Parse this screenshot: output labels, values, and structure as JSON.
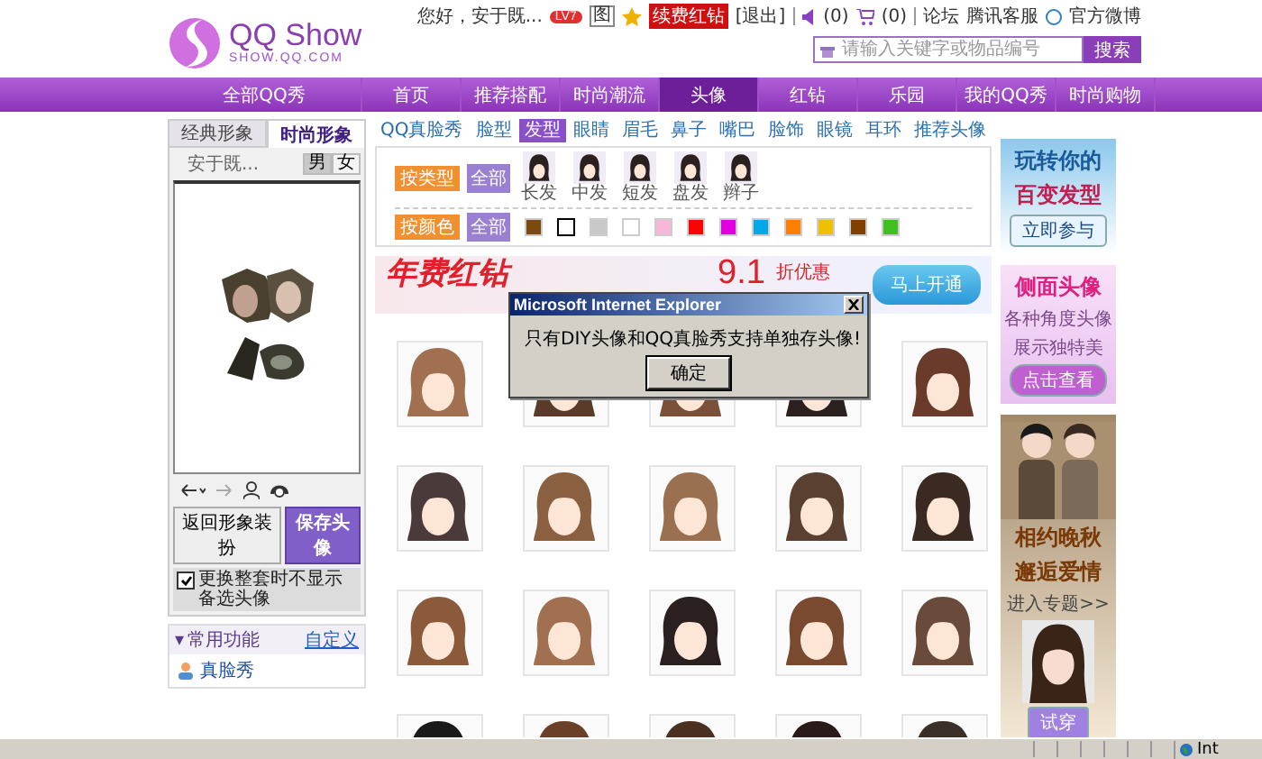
{
  "header": {
    "logo": "QQ Show",
    "logo_url": "SHOW.QQ.COM",
    "greeting": "您好，安于既...",
    "level_badge": "LV7",
    "photo_toggle": "图",
    "renew_button": "续费红钻",
    "logout": "[退出]",
    "messages": "(0)",
    "cart": "(0)",
    "links": [
      "论坛",
      "腾讯客服",
      "官方微博"
    ]
  },
  "search": {
    "placeholder": "请输入关键字或物品编号",
    "button": "搜索"
  },
  "nav": [
    {
      "label": "全部QQ秀",
      "selected": false
    },
    {
      "label": "首页",
      "selected": false
    },
    {
      "label": "推荐搭配",
      "selected": false
    },
    {
      "label": "时尚潮流",
      "selected": false
    },
    {
      "label": "头像",
      "selected": true
    },
    {
      "label": "红钻",
      "selected": false
    },
    {
      "label": "乐园",
      "selected": false
    },
    {
      "label": "我的QQ秀",
      "selected": false
    },
    {
      "label": "时尚购物",
      "selected": false
    }
  ],
  "left_panel": {
    "tabs": [
      {
        "label": "经典形象",
        "selected": false
      },
      {
        "label": "时尚形象",
        "selected": true
      }
    ],
    "user_name": "安于既...",
    "genders": [
      {
        "label": "男",
        "selected": true
      },
      {
        "label": "女",
        "selected": false
      }
    ],
    "buttons": [
      "返回形象装扮",
      "保存头像"
    ],
    "option": {
      "label": "更换整套时不显示备选头像",
      "checked": true
    },
    "section": {
      "toggle": "▾",
      "title": "常用功能",
      "link": "自定义",
      "items": [
        "真脸秀"
      ]
    }
  },
  "subtabs": [
    {
      "label": "QQ真脸秀",
      "selected": false
    },
    {
      "label": "脸型",
      "selected": false
    },
    {
      "label": "发型",
      "selected": true
    },
    {
      "label": "眼睛",
      "selected": false
    },
    {
      "label": "眉毛",
      "selected": false
    },
    {
      "label": "鼻子",
      "selected": false
    },
    {
      "label": "嘴巴",
      "selected": false
    },
    {
      "label": "脸饰",
      "selected": false
    },
    {
      "label": "眼镜",
      "selected": false
    },
    {
      "label": "耳环",
      "selected": false
    },
    {
      "label": "推荐头像",
      "selected": false
    }
  ],
  "filters": {
    "type_label": "按类型",
    "type_all": "全部",
    "types": [
      "长发",
      "中发",
      "短发",
      "盘发",
      "辫子"
    ],
    "color_label": "按颜色",
    "color_all": "全部",
    "swatches": [
      {
        "color": "#7a4a10",
        "selected": false
      },
      {
        "color": "#ffffff",
        "selected": true
      },
      {
        "color": "#c8c8c8",
        "selected": false
      },
      {
        "color": "#ffffff",
        "selected": false
      },
      {
        "color": "#f7b8d8",
        "selected": false
      },
      {
        "color": "#ff0000",
        "selected": false
      },
      {
        "color": "#e000e0",
        "selected": false
      },
      {
        "color": "#00a8e8",
        "selected": false
      },
      {
        "color": "#ff8000",
        "selected": false
      },
      {
        "color": "#f0c000",
        "selected": false
      },
      {
        "color": "#804000",
        "selected": false
      },
      {
        "color": "#40c020",
        "selected": false
      }
    ]
  },
  "banner": {
    "title": "年费红钻",
    "discount": "9.1",
    "suffix": "折优惠",
    "button": "马上开通"
  },
  "hair_items": [
    {
      "color": "#a07050"
    },
    {
      "color": "#5a3a28"
    },
    {
      "color": "#7a5038"
    },
    {
      "color": "#2a2020"
    },
    {
      "color": "#6a3a2a"
    },
    {
      "color": "#4a3a3a"
    },
    {
      "color": "#8a6040"
    },
    {
      "color": "#9a7050"
    },
    {
      "color": "#5a4030"
    },
    {
      "color": "#3a2a22"
    },
    {
      "color": "#8a5a3a"
    },
    {
      "color": "#a07050"
    },
    {
      "color": "#2a2020"
    },
    {
      "color": "#7a4a30"
    },
    {
      "color": "#6a4a3a"
    },
    {
      "color": "#1a1a1a"
    },
    {
      "color": "#6a4028"
    },
    {
      "color": "#4a3020"
    },
    {
      "color": "#2a1a1a"
    },
    {
      "color": "#3a3028"
    }
  ],
  "dialog": {
    "title": "Microsoft Internet Explorer",
    "message": "只有DIY头像和QQ真脸秀支持单独存头像!",
    "button": "确定"
  },
  "ads": [
    {
      "kind": "hairstyle",
      "lines": [
        "玩转你的",
        "百变发型"
      ],
      "button": "立即参与"
    },
    {
      "kind": "profile",
      "title": "侧面头像",
      "lines": [
        "各种角度头像",
        "展示独特美"
      ],
      "button": "点击查看"
    },
    {
      "kind": "feature",
      "lines": [
        "相约晚秋",
        "邂逅爱情"
      ],
      "link": "进入专题>>",
      "button": "试穿"
    }
  ],
  "status_bar": {
    "zone": "Int"
  }
}
